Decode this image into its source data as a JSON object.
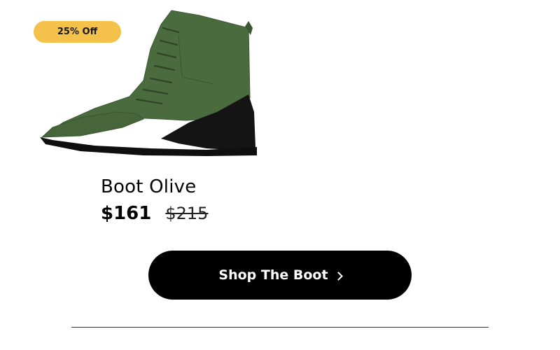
{
  "badge": {
    "label": "25% Off"
  },
  "product": {
    "image_icon": "boot-image",
    "name": "Boot Olive",
    "price": "$161",
    "original_price": "$215"
  },
  "cta": {
    "label": "Shop The Boot",
    "icon": "chevron-right-icon"
  },
  "colors": {
    "badge": "#f4c14a",
    "boot": "#4a6b3e",
    "sole": "#111111",
    "button": "#000000"
  }
}
